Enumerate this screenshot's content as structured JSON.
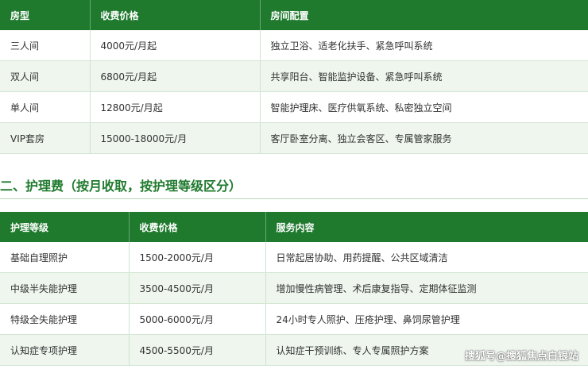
{
  "room_table": {
    "headers": [
      "房型",
      "收费价格",
      "房间配置"
    ],
    "rows": [
      [
        "三人间",
        "4000元/月起",
        "独立卫浴、适老化扶手、紧急呼叫系统"
      ],
      [
        "双人间",
        "6800元/月起",
        "共享阳台、智能监护设备、紧急呼叫系统"
      ],
      [
        "单人间",
        "12800元/月起",
        "智能护理床、医疗供氧系统、私密独立空间"
      ],
      [
        "VIP套房",
        "15000-18000元/月",
        "客厅卧室分离、独立会客区、专属管家服务"
      ]
    ]
  },
  "care_section": {
    "heading": "二、护理费（按月收取，按护理等级区分）",
    "headers": [
      "护理等级",
      "收费价格",
      "服务内容"
    ],
    "rows": [
      [
        "基础自理照护",
        "1500-2000元/月",
        "日常起居协助、用药提醒、公共区域清洁"
      ],
      [
        "中级半失能护理",
        "3500-4500元/月",
        "增加慢性病管理、术后康复指导、定期体征监测"
      ],
      [
        "特级全失能护理",
        "5000-6000元/月",
        "24小时专人照护、压疮护理、鼻饲尿管护理"
      ],
      [
        "认知症专项护理",
        "4500-5500元/月",
        "认知症干预训练、专人专属照护方案"
      ]
    ]
  },
  "watermark": "搜狐号@搜狐焦点白银站",
  "colors": {
    "header_bg": "#1f7a2e",
    "alt_row_bg": "#eef6ee",
    "heading_text": "#1f7a2e"
  }
}
